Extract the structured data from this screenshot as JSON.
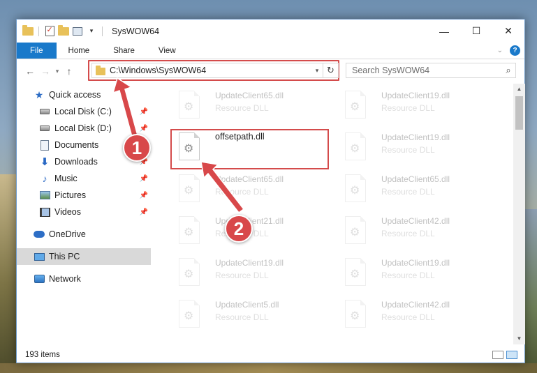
{
  "window": {
    "title": "SysWOW64"
  },
  "ribbon": {
    "tabs": [
      {
        "label": "File"
      },
      {
        "label": "Home"
      },
      {
        "label": "Share"
      },
      {
        "label": "View"
      }
    ],
    "help": "?"
  },
  "address": {
    "path": "C:\\Windows\\SysWOW64"
  },
  "search": {
    "placeholder": "Search SysWOW64"
  },
  "sidebar": {
    "items": [
      {
        "label": "Quick access"
      },
      {
        "label": "Local Disk (C:)"
      },
      {
        "label": "Local Disk (D:)"
      },
      {
        "label": "Documents"
      },
      {
        "label": "Downloads"
      },
      {
        "label": "Music"
      },
      {
        "label": "Pictures"
      },
      {
        "label": "Videos"
      },
      {
        "label": "OneDrive"
      },
      {
        "label": "This PC"
      },
      {
        "label": "Network"
      }
    ]
  },
  "files": {
    "left": [
      {
        "name": "UpdateClient65.dll",
        "type": "Resource DLL"
      },
      {
        "name": "offsetpath.dll",
        "type": ""
      },
      {
        "name": "UpdateClient65.dll",
        "type": "Resource DLL"
      },
      {
        "name": "UpdateClient21.dll",
        "type": "Resource DLL"
      },
      {
        "name": "UpdateClient19.dll",
        "type": "Resource DLL"
      },
      {
        "name": "UpdateClient5.dll",
        "type": "Resource DLL"
      }
    ],
    "right": [
      {
        "name": "UpdateClient19.dll",
        "type": "Resource DLL"
      },
      {
        "name": "UpdateClient19.dll",
        "type": "Resource DLL"
      },
      {
        "name": "UpdateClient65.dll",
        "type": "Resource DLL"
      },
      {
        "name": "UpdateClient42.dll",
        "type": "Resource DLL"
      },
      {
        "name": "UpdateClient19.dll",
        "type": "Resource DLL"
      },
      {
        "name": "UpdateClient42.dll",
        "type": "Resource DLL"
      }
    ]
  },
  "status": {
    "count": "193 items"
  },
  "annotations": {
    "marker1": "1",
    "marker2": "2"
  },
  "colors": {
    "accent": "#1979ca",
    "highlight": "#d44b4b"
  }
}
